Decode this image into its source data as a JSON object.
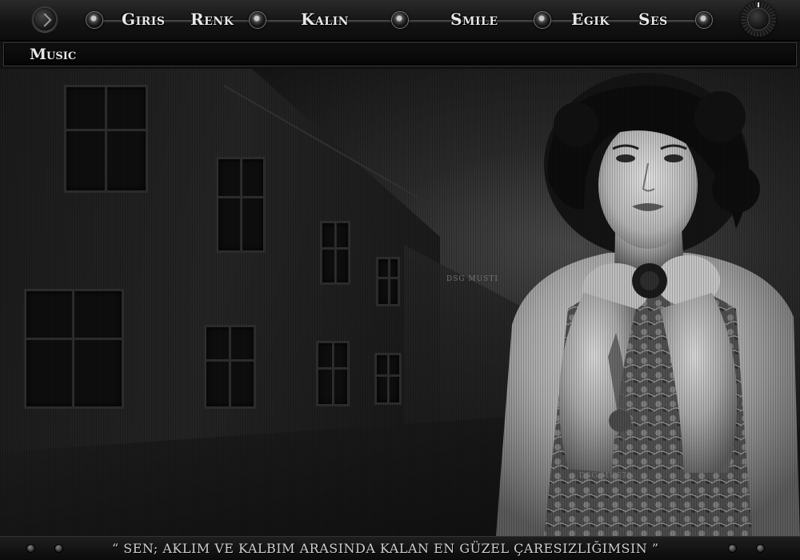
{
  "nav": {
    "items": [
      {
        "label": "Giris"
      },
      {
        "label": "Renk"
      },
      {
        "label": "Kalin"
      },
      {
        "label": "Smile"
      },
      {
        "label": "Egik"
      },
      {
        "label": "Ses"
      }
    ]
  },
  "music_bar": {
    "label": "Music"
  },
  "scene": {
    "watermark_top": "DSG MUSTI",
    "watermark_bottom": "DSG MUSTI"
  },
  "footer": {
    "quote": "“ SEN; AKLIM VE KALBIM ARASINDA KALAN EN GÜZEL ÇARESIZLIĞIMSIN ”"
  }
}
